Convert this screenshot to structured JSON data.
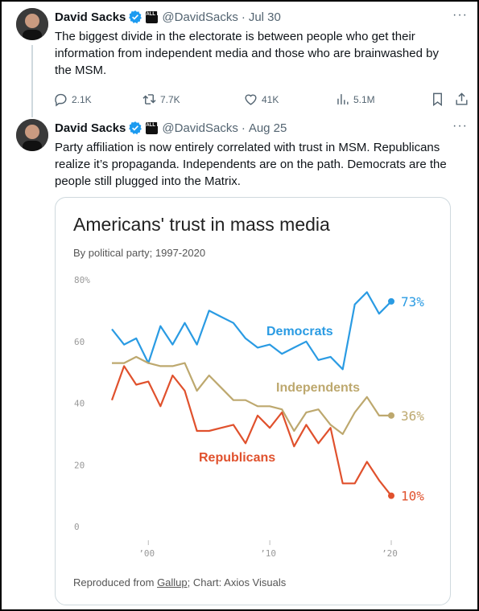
{
  "tweets": [
    {
      "name": "David Sacks",
      "affiliate_badge": "ALL IN",
      "handle": "@DavidSacks",
      "separator": "·",
      "date": "Jul 30",
      "more": "···",
      "text_lines": [
        "The biggest divide in the electorate is between people who get their",
        "information from independent media and those who are brainwashed by",
        "the MSM."
      ],
      "stats": {
        "replies": "2.1K",
        "reposts": "7.7K",
        "likes": "41K",
        "views": "5.1M"
      }
    },
    {
      "name": "David Sacks",
      "affiliate_badge": "ALL IN",
      "handle": "@DavidSacks",
      "separator": "·",
      "date": "Aug 25",
      "more": "···",
      "text_lines": [
        "Party affiliation is now entirely correlated with trust in MSM. Republicans",
        "realize it’s propaganda. Independents are on the path. Democrats are the",
        "people still plugged into the Matrix."
      ]
    }
  ],
  "icons": {
    "reply": "reply-icon",
    "repost": "repost-icon",
    "like": "heart-icon",
    "views": "views-icon",
    "bookmark": "bookmark-icon",
    "share": "share-icon",
    "verified": "verified-badge-icon",
    "more": "more-icon"
  },
  "colors": {
    "verified": "#1d9bf0",
    "democrats": "#2a9be3",
    "independents": "#bda86e",
    "republicans": "#e0512d"
  },
  "chart_data": {
    "type": "line",
    "title": "Americans' trust in mass media",
    "subtitle": "By political party; 1997-2020",
    "source_prefix": "Reproduced from ",
    "source_link": "Gallup",
    "source_suffix": "; Chart: Axios Visuals",
    "y_ticks": [
      "80%",
      "60",
      "40",
      "20",
      "0"
    ],
    "y_tick_values": [
      80,
      60,
      40,
      20,
      0
    ],
    "x_ticks": [
      "’00",
      "’10",
      "’20"
    ],
    "x_tick_values": [
      2000,
      2010,
      2020
    ],
    "xlim": [
      1997,
      2020
    ],
    "ylim": [
      0,
      80
    ],
    "grid": false,
    "legend": "inline labels",
    "x": [
      1997,
      1998,
      1999,
      2000,
      2001,
      2002,
      2003,
      2004,
      2005,
      2006,
      2007,
      2008,
      2009,
      2010,
      2011,
      2012,
      2013,
      2014,
      2015,
      2016,
      2017,
      2018,
      2019,
      2020
    ],
    "series": [
      {
        "name": "Democrats",
        "color": "#2a9be3",
        "end_label": "73%",
        "values": [
          64,
          59,
          61,
          53,
          65,
          59,
          66,
          59,
          70,
          68,
          66,
          61,
          58,
          59,
          56,
          58,
          60,
          54,
          55,
          51,
          72,
          76,
          69,
          73
        ]
      },
      {
        "name": "Independents",
        "color": "#bda86e",
        "end_label": "36%",
        "values": [
          53,
          53,
          55,
          53,
          52,
          52,
          53,
          44,
          49,
          45,
          41,
          41,
          39,
          39,
          38,
          31,
          37,
          38,
          33,
          30,
          37,
          42,
          36,
          36
        ]
      },
      {
        "name": "Republicans",
        "color": "#e0512d",
        "end_label": "10%",
        "values": [
          41,
          52,
          46,
          47,
          39,
          49,
          44,
          31,
          31,
          32,
          33,
          27,
          36,
          32,
          37,
          26,
          33,
          27,
          32,
          14,
          14,
          21,
          15,
          10
        ]
      }
    ]
  }
}
